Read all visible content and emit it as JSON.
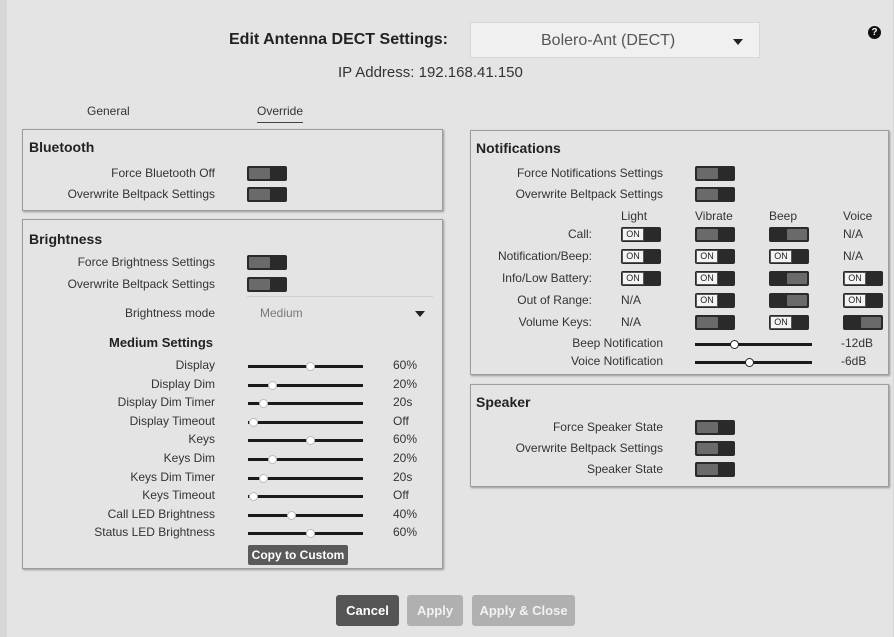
{
  "header": {
    "title": "Edit Antenna DECT Settings:",
    "device": "Bolero-Ant (DECT)",
    "ip_address": "IP Address: 192.168.41.150",
    "help": "?"
  },
  "tabs": [
    {
      "label": "General",
      "active": false
    },
    {
      "label": "Override",
      "active": true
    }
  ],
  "bluetooth": {
    "title": "Bluetooth",
    "rows": [
      {
        "label": "Force Bluetooth Off",
        "on": false
      },
      {
        "label": "Overwrite Beltpack Settings",
        "on": false
      }
    ]
  },
  "brightness": {
    "title": "Brightness",
    "rows": [
      {
        "label": "Force Brightness Settings",
        "on": false
      },
      {
        "label": "Overwrite Beltpack Settings",
        "on": false
      }
    ],
    "mode_label": "Brightness mode",
    "mode_value": "Medium",
    "medium_title": "Medium Settings",
    "sliders": [
      {
        "label": "Display",
        "value": "60%",
        "level": 0.6
      },
      {
        "label": "Display Dim",
        "value": "20%",
        "level": 0.2
      },
      {
        "label": "Display Dim Timer",
        "value": "20s",
        "level": 0.1
      },
      {
        "label": "Display Timeout",
        "value": "Off",
        "level": 0.0
      },
      {
        "label": "Keys",
        "value": "60%",
        "level": 0.6
      },
      {
        "label": "Keys Dim",
        "value": "20%",
        "level": 0.2
      },
      {
        "label": "Keys Dim Timer",
        "value": "20s",
        "level": 0.1
      },
      {
        "label": "Keys Timeout",
        "value": "Off",
        "level": 0.0
      },
      {
        "label": "Call LED Brightness",
        "value": "40%",
        "level": 0.4
      },
      {
        "label": "Status LED Brightness",
        "value": "60%",
        "level": 0.6
      }
    ],
    "copy_button": "Copy to Custom"
  },
  "notifications": {
    "title": "Notifications",
    "rows": [
      {
        "label": "Force Notifications Settings",
        "on": false
      },
      {
        "label": "Overwrite Beltpack Settings",
        "on": false
      }
    ],
    "columns": [
      "Light",
      "Vibrate",
      "Beep",
      "Voice"
    ],
    "on_text": "ON",
    "na_text": "N/A",
    "matrix": [
      {
        "label": "Call:",
        "cells": [
          "on",
          "off",
          "offR",
          "na"
        ]
      },
      {
        "label": "Notification/Beep:",
        "cells": [
          "on",
          "on",
          "on",
          "na"
        ]
      },
      {
        "label": "Info/Low Battery:",
        "cells": [
          "on",
          "on",
          "offR",
          "on"
        ]
      },
      {
        "label": "Out of Range:",
        "cells": [
          "na",
          "on",
          "offR",
          "on"
        ]
      },
      {
        "label": "Volume Keys:",
        "cells": [
          "na",
          "off",
          "on",
          "offR"
        ]
      }
    ],
    "volume_sliders": [
      {
        "label": "Beep Notification",
        "value": "-12dB",
        "level": 0.35
      },
      {
        "label": "Voice Notification",
        "value": "-6dB",
        "level": 0.5
      }
    ]
  },
  "speaker": {
    "title": "Speaker",
    "rows": [
      {
        "label": "Force Speaker State",
        "on": false
      },
      {
        "label": "Overwrite Beltpack Settings",
        "on": false
      },
      {
        "label": "Speaker State",
        "on": false
      }
    ]
  },
  "footer": {
    "cancel": "Cancel",
    "apply": "Apply",
    "apply_close": "Apply & Close"
  }
}
